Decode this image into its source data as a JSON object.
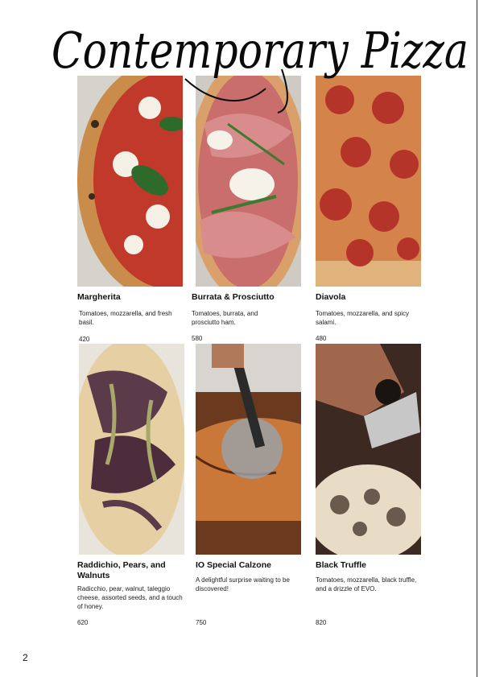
{
  "menu": {
    "title": "Contemporary Pizza",
    "page_number": "2",
    "items": [
      {
        "name": "Margherita",
        "description": "Tomatoes, mozzarella, and fresh basil.",
        "price": "420",
        "photo": "margherita-photo"
      },
      {
        "name": "Burrata & Prosciutto",
        "description": "Tomatoes, burrata, and prosciutto ham.",
        "price": "580",
        "photo": "burrata-prosciutto-photo"
      },
      {
        "name": "Diavola",
        "description": "Tomatoes, mozzarella, and spicy salami.",
        "price": "480",
        "photo": "diavola-photo"
      },
      {
        "name": "Raddichio, Pears, and Walnuts",
        "description": "Radicchio, pear, walnut, taleggio cheese, assorted seeds, and a touch of honey.",
        "price": "620",
        "photo": "radicchio-pear-photo"
      },
      {
        "name": "IO Special Calzone",
        "description": "A delightful surprise waiting to be discovered!",
        "price": "750",
        "photo": "calzone-photo"
      },
      {
        "name": "Black Truffle",
        "description": "Tomatoes, mozzarella, black truffle, and a drizzle of EVO.",
        "price": "820",
        "photo": "black-truffle-photo"
      }
    ]
  },
  "colors": {
    "text": "#111111",
    "crust": "#d9b27a",
    "sauce": "#c0392b",
    "basil": "#2e6b2a",
    "wood": "#6b3a1e"
  }
}
